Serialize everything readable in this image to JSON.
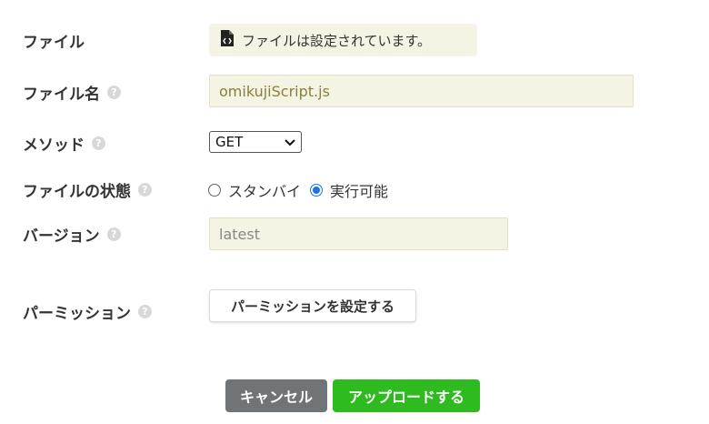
{
  "labels": {
    "file": "ファイル",
    "filename": "ファイル名",
    "method": "メソッド",
    "file_state": "ファイルの状態",
    "version": "バージョン",
    "permission": "パーミッション"
  },
  "help_glyph": "?",
  "file_status": {
    "text": "ファイルは設定されています。",
    "icon": "file-code-icon"
  },
  "filename_value": "omikujiScript.js",
  "method": {
    "selected": "GET",
    "options": [
      "GET"
    ]
  },
  "file_state": {
    "options": [
      "スタンバイ",
      "実行可能"
    ],
    "selected": "実行可能"
  },
  "version_value": "latest",
  "buttons": {
    "set_permission": "パーミッションを設定する",
    "cancel": "キャンセル",
    "upload": "アップロードする"
  },
  "colors": {
    "input_bg": "#f5f3e4",
    "cancel_bg": "#6f7478",
    "upload_bg": "#2dbb1f",
    "radio_accent": "#1a73e8"
  }
}
